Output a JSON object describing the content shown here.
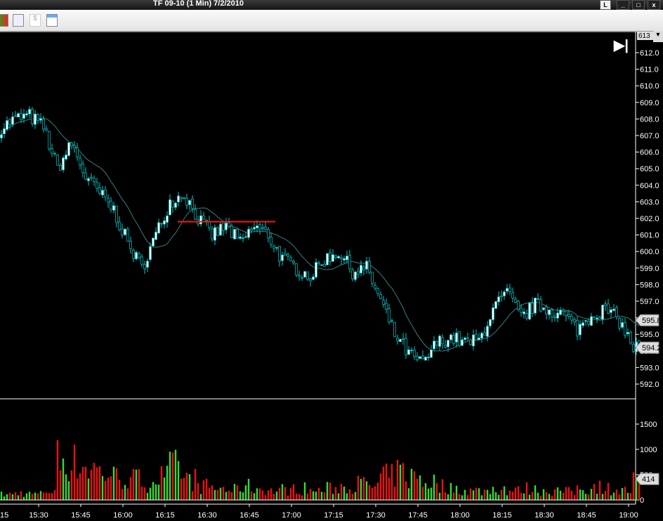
{
  "window": {
    "title": "TF 09-10 (1 Min)  7/2/2010",
    "l_button": "L",
    "minimize": "_",
    "maximize": "□",
    "close": "x"
  },
  "toolbar": {
    "icons": [
      "candlestick-icon",
      "indicator-icon",
      "dollar-icon",
      "data-box-icon"
    ]
  },
  "colors": {
    "up": "#ffffff",
    "down": "#00c8c8",
    "ma": "#3a7f7f",
    "level": "#ff1010",
    "vol_up": "#33dd33",
    "vol_down": "#ee1111",
    "axis": "#ffffff"
  },
  "chart_data": {
    "type": "candlestick",
    "title": "TF 09-10 (1 Min)  7/2/2010",
    "price_ylim": [
      591.5,
      613.5
    ],
    "price_ticks": [
      "612.0",
      "611.0",
      "610.0",
      "609.0",
      "608.0",
      "607.0",
      "606.0",
      "605.0",
      "604.0",
      "603.0",
      "602.0",
      "601.0",
      "600.0",
      "599.0",
      "598.0",
      "597.0",
      "596.0",
      "595.0",
      "594.0",
      "593.0",
      "592.0"
    ],
    "price_tick_values": [
      612,
      611,
      610,
      609,
      608,
      607,
      606,
      605,
      604,
      603,
      602,
      601,
      600,
      599,
      598,
      597,
      596,
      595,
      594,
      593,
      592
    ],
    "top_label": "613",
    "last_price_label": "594.2",
    "ma_label": "595.8",
    "horizontal_line": {
      "price": 601.8,
      "from": "16:20",
      "to": "16:55"
    },
    "close_samples_5min": {
      "start": "15:16",
      "values": [
        607.5,
        608.0,
        608.2,
        607.5,
        605.0,
        606.5,
        604.5,
        603.5,
        602.5,
        600.5,
        599.0,
        601.0,
        603.0,
        603.5,
        602.0,
        601.0,
        601.5,
        600.5,
        601.5,
        601.0,
        599.5,
        599.0,
        598.5,
        599.5,
        600.0,
        598.8,
        599.0,
        597.0,
        595.0,
        593.8,
        593.2,
        594.5,
        594.8,
        594.5,
        594.6,
        596.5,
        597.5,
        596.0,
        596.8,
        596.5,
        596.2,
        595.3,
        596.2,
        596.5,
        595.8,
        594.2
      ]
    },
    "volume_ylim": [
      0,
      1800
    ],
    "volume_ticks": [
      "1500",
      "1000",
      "500",
      "0"
    ],
    "volume_tick_values": [
      1500,
      1000,
      500,
      0
    ],
    "volume_label": "414",
    "volume_samples_5min": [
      120,
      150,
      130,
      200,
      900,
      800,
      700,
      600,
      500,
      450,
      400,
      500,
      700,
      450,
      300,
      250,
      220,
      300,
      250,
      200,
      230,
      250,
      200,
      250,
      300,
      350,
      300,
      500,
      600,
      500,
      400,
      300,
      250,
      200,
      200,
      250,
      200,
      250,
      220,
      200,
      180,
      250,
      300,
      250,
      200,
      414
    ],
    "time_ticks": [
      "15:30",
      "15:45",
      "16:00",
      "16:15",
      "16:30",
      "16:45",
      "17:00",
      "17:15",
      "17:30",
      "17:45",
      "18:00",
      "18:15",
      "18:30",
      "18:45",
      "19:00"
    ],
    "time_tick_partial": "15"
  }
}
